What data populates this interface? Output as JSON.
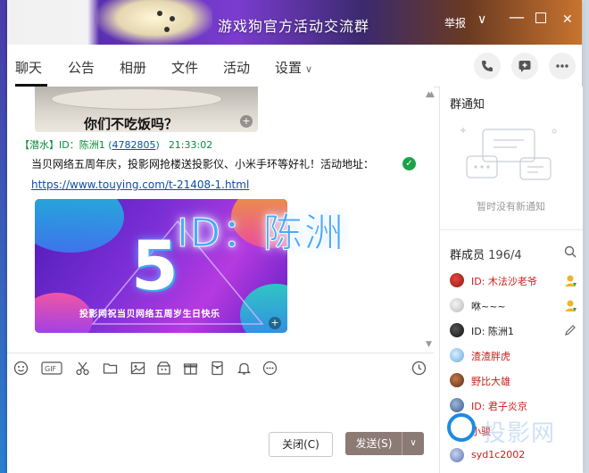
{
  "window": {
    "title": "游戏狗官方活动交流群",
    "report_label": "举报",
    "chevron_glyph": "∨",
    "min_glyph": "—",
    "close_glyph": "✕"
  },
  "tabs": [
    {
      "label": "聊天"
    },
    {
      "label": "公告"
    },
    {
      "label": "相册"
    },
    {
      "label": "文件"
    },
    {
      "label": "活动"
    },
    {
      "label": "设置"
    }
  ],
  "tab_settings_chevron": "∨",
  "chat": {
    "image_caption": "你们不吃饭吗？",
    "zoom_glyph": "+",
    "message": {
      "rank": "【潜水】",
      "sender_prefix": "ID：陈洲1",
      "uid": "4782805",
      "time": "21:33:02",
      "text": "当贝网络五周年庆，投影网抢楼送投影仪、小米手环等好礼！活动地址：",
      "link": "https://www.touying.com/t-21408-1.html",
      "shield_glyph": "✓"
    },
    "poster": {
      "big_number": "5",
      "banner": "投影网祝当贝网络五周岁生日快乐"
    },
    "watermark": "ID：陈洲"
  },
  "toolbar_icons": [
    "emoji-icon",
    "gif-icon",
    "scissors-icon",
    "folder-icon",
    "image-icon",
    "gift-box-icon",
    "gift-icon",
    "red-packet-icon",
    "bell-icon",
    "more-dots-icon",
    "history-clock-icon"
  ],
  "toolbar": {
    "gif_label": "GIF"
  },
  "buttons": {
    "close_label": "关闭(C)",
    "send_label": "发送(S)",
    "send_caret": "∨"
  },
  "panel": {
    "notice_title": "群通知",
    "notice_empty": "暂时没有新通知",
    "members_title": "群成员",
    "members_count": "196/4",
    "members": [
      {
        "name": "ID: 木法沙老爷",
        "color": "red",
        "badge": "admin"
      },
      {
        "name": "咻~~~",
        "color": "dark",
        "badge": "admin"
      },
      {
        "name": "ID: 陈洲1",
        "color": "dark",
        "badge": "edit"
      },
      {
        "name": "渣渣胖虎",
        "color": "red",
        "badge": ""
      },
      {
        "name": "野比大雄",
        "color": "red",
        "badge": ""
      },
      {
        "name": "ID: 君子炎京",
        "color": "red",
        "badge": ""
      },
      {
        "name": "小骏",
        "color": "red",
        "badge": ""
      },
      {
        "name": "syd1c2002",
        "color": "red",
        "badge": ""
      }
    ],
    "watermark": "投影网"
  }
}
